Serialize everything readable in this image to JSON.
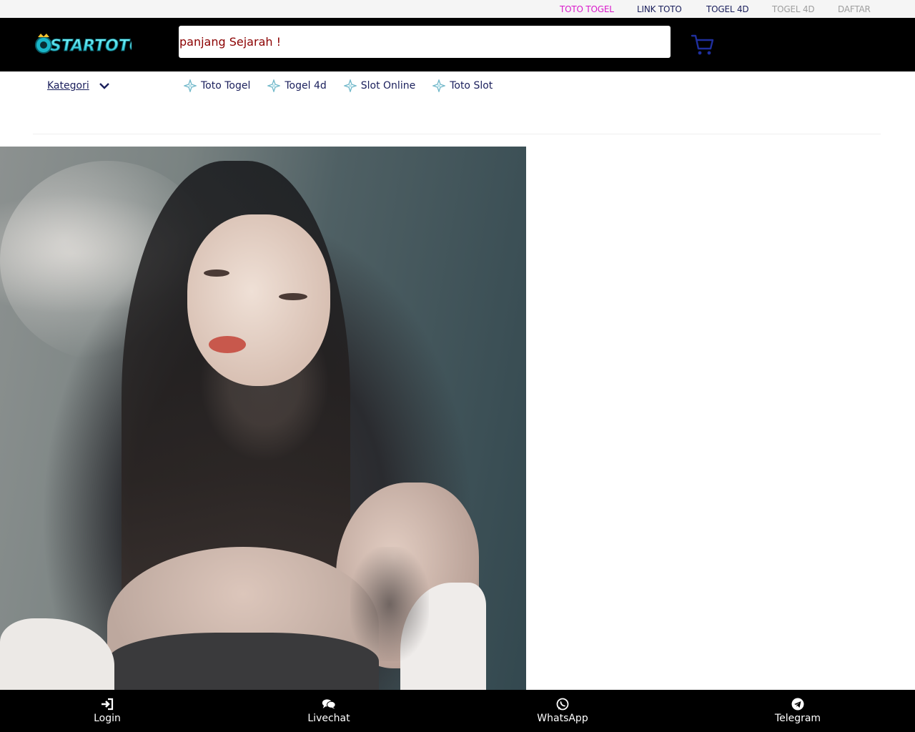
{
  "topbar": {
    "links": [
      {
        "label": "TOTO TOGEL",
        "color": "#d91acb"
      },
      {
        "label": "LINK TOTO",
        "color": "#1a1f5c"
      },
      {
        "label": "TOGEL 4D",
        "color": "#1a1f5c"
      },
      {
        "label": "TOGEL 4D",
        "color": "#9e9e9e"
      },
      {
        "label": "DAFTAR",
        "color": "#9e9e9e"
      }
    ]
  },
  "header": {
    "logo_text": "STARTOTO",
    "search_value": "panjang Sejarah !",
    "cart_icon": "shopping-cart-icon"
  },
  "category": {
    "label": "Kategori",
    "links": [
      {
        "label": "Toto Togel"
      },
      {
        "label": "Togel 4d"
      },
      {
        "label": "Slot Online"
      },
      {
        "label": "Toto Slot"
      }
    ]
  },
  "bottom_nav": {
    "items": [
      {
        "label": "Login",
        "icon": "login-icon"
      },
      {
        "label": "Livechat",
        "icon": "chat-icon"
      },
      {
        "label": "WhatsApp",
        "icon": "whatsapp-icon"
      },
      {
        "label": "Telegram",
        "icon": "telegram-icon"
      }
    ]
  },
  "colors": {
    "header_bg": "#000000",
    "nav_text": "#1a1f5c",
    "accent_pink": "#d91acb",
    "search_text": "#8b0000",
    "cart_blue": "#1f2f9e"
  }
}
